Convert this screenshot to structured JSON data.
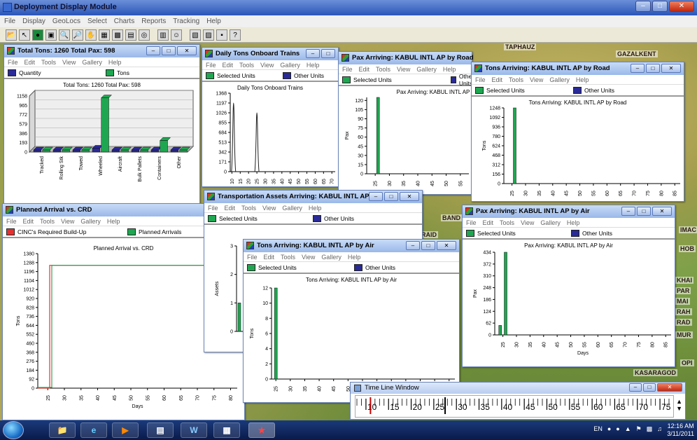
{
  "app": {
    "title": "Deployment Display Module"
  },
  "menu": [
    "File",
    "Display",
    "GeoLocs",
    "Select",
    "Charts",
    "Reports",
    "Tracking",
    "Help"
  ],
  "child_menu": [
    "File",
    "Edit",
    "Tools",
    "View",
    "Gallery",
    "Help"
  ],
  "map_labels": [
    "TAPHAUZ",
    "GAZALKENT",
    "IMAC",
    "HOB",
    "KHAI",
    "PAR",
    "MAI",
    "RAH",
    "RAD",
    "MUR",
    "OPI",
    "KASARAGOD",
    "BAND",
    "RAID"
  ],
  "windows": {
    "total_tons": {
      "title": "Total Tons: 1260  Total Pax: 598",
      "legend": [
        "Quantity",
        "Tons"
      ],
      "chart_data": {
        "type": "bar",
        "title": "Total Tons: 1260  Total Pax: 598",
        "categories": [
          "Tracked",
          "Rolling Stk",
          "Towed",
          "Wheeled",
          "Aircraft",
          "Bulk Pallets",
          "Containers",
          "Other"
        ],
        "series": [
          {
            "name": "Quantity",
            "values": [
              0,
              0,
              0,
              80,
              0,
              0,
              0,
              0
            ]
          },
          {
            "name": "Tons",
            "values": [
              0,
              0,
              0,
              1120,
              0,
              0,
              240,
              0
            ]
          }
        ],
        "yticks": [
          0,
          193,
          386,
          579,
          772,
          965,
          1158
        ],
        "ylim": [
          0,
          1158
        ]
      }
    },
    "daily_tons_trains": {
      "title": "Daily Tons Onboard Trains",
      "legend": [
        "Selected Units",
        "Other Units"
      ],
      "chart_data": {
        "type": "line",
        "title": "Daily Tons Onboard Trains",
        "yticks": [
          0,
          171,
          342,
          513,
          684,
          855,
          1026,
          1197,
          1368
        ],
        "xticks": [
          10,
          15,
          20,
          25,
          30,
          35,
          40,
          45,
          50,
          55,
          60,
          65,
          70
        ],
        "peaks": [
          {
            "x": 11,
            "y": 1197
          },
          {
            "x": 25,
            "y": 1026
          }
        ],
        "ylim": [
          0,
          1368
        ]
      }
    },
    "pax_road": {
      "title": "Pax Arriving: KABUL INTL AP by Road",
      "legend": [
        "Selected Units",
        "Other Units"
      ],
      "chart_data": {
        "type": "bar",
        "title": "Pax Arriving: KABUL INTL AP",
        "ylabel": "Pax",
        "yticks": [
          0,
          15,
          30,
          45,
          60,
          75,
          90,
          105,
          120
        ],
        "xticks": [
          25,
          30,
          35,
          40,
          45,
          50,
          55
        ],
        "bars": [
          {
            "x": 26,
            "y": 125
          }
        ],
        "ylim": [
          0,
          125
        ]
      }
    },
    "tons_road": {
      "title": "Tons Arriving: KABUL INTL AP by Road",
      "legend": [
        "Selected Units",
        "Other Units"
      ],
      "chart_data": {
        "type": "bar",
        "title": "Tons Arriving: KABUL INTL AP by Road",
        "ylabel": "Tons",
        "yticks": [
          0,
          156,
          312,
          468,
          624,
          780,
          936,
          1092,
          1248
        ],
        "xticks": [
          25,
          30,
          35,
          40,
          45,
          50,
          55,
          60,
          65,
          70,
          75,
          80,
          85
        ],
        "bars": [
          {
            "x": 26,
            "y": 1248
          }
        ],
        "ylim": [
          0,
          1248
        ]
      }
    },
    "planned_crd": {
      "title": "Planned Arrival vs. CRD",
      "legend": [
        "CINC's Required Build-Up",
        "Planned Arrivals"
      ],
      "chart_data": {
        "type": "line",
        "title": "Planned Arrival vs. CRD",
        "ylabel": "Tons",
        "xlabel": "Days",
        "yticks": [
          0,
          92,
          184,
          276,
          368,
          460,
          552,
          644,
          736,
          828,
          920,
          1012,
          1104,
          1196,
          1288,
          1380
        ],
        "xticks": [
          25,
          30,
          35,
          40,
          45,
          50,
          55,
          60,
          65,
          70,
          75,
          80
        ],
        "step_x": 26,
        "step_y": 1260,
        "ylim": [
          0,
          1380
        ]
      }
    },
    "transport_assets": {
      "title": "Transportation Assets Arriving: KABUL INTL AP ...",
      "legend": [
        "Selected Units",
        "Other Units"
      ],
      "chart_data": {
        "type": "bar",
        "ylabel": "Assets",
        "yticks": [
          0,
          1,
          2,
          3
        ],
        "bars": [
          {
            "x": 25,
            "y": 1
          }
        ],
        "ylim": [
          0,
          3
        ]
      }
    },
    "tons_air": {
      "title": "Tons Arriving: KABUL INTL AP by Air",
      "legend": [
        "Selected Units",
        "Other Units"
      ],
      "chart_data": {
        "type": "bar",
        "title": "Tons Arriving: KABUL INTL AP by Air",
        "ylabel": "Tons",
        "yticks": [
          0,
          2,
          4,
          6,
          8,
          10,
          12
        ],
        "xticks": [
          25,
          30,
          35,
          40,
          45,
          50,
          55,
          60,
          65,
          70,
          75,
          80,
          85
        ],
        "bars": [
          {
            "x": 25,
            "y": 12
          }
        ],
        "ylim": [
          0,
          12
        ]
      }
    },
    "pax_air": {
      "title": "Pax Arriving: KABUL INTL AP by Air",
      "legend": [
        "Selected Units",
        "Other Units"
      ],
      "chart_data": {
        "type": "bar",
        "title": "Pax Arriving: KABUL INTL AP by Air",
        "ylabel": "Pax",
        "xlabel": "Days",
        "yticks": [
          0,
          62,
          124,
          186,
          248,
          310,
          372,
          434
        ],
        "xticks": [
          25,
          30,
          35,
          40,
          45,
          50,
          55,
          60,
          65,
          70,
          75,
          80,
          85
        ],
        "bars": [
          {
            "x": 24,
            "y": 50
          },
          {
            "x": 26,
            "y": 434
          }
        ],
        "ylim": [
          0,
          434
        ]
      }
    }
  },
  "timeline": {
    "title": "Time Line Window",
    "ticks": [
      10,
      15,
      20,
      25,
      30,
      35,
      40,
      45,
      50,
      55,
      60,
      65,
      70,
      75
    ]
  },
  "taskbar": {
    "lang": "EN",
    "time": "12:16 AM",
    "date": "3/11/2011"
  },
  "colors": {
    "green": "#1ea650",
    "navy": "#2a2a98",
    "red": "#e83030"
  }
}
